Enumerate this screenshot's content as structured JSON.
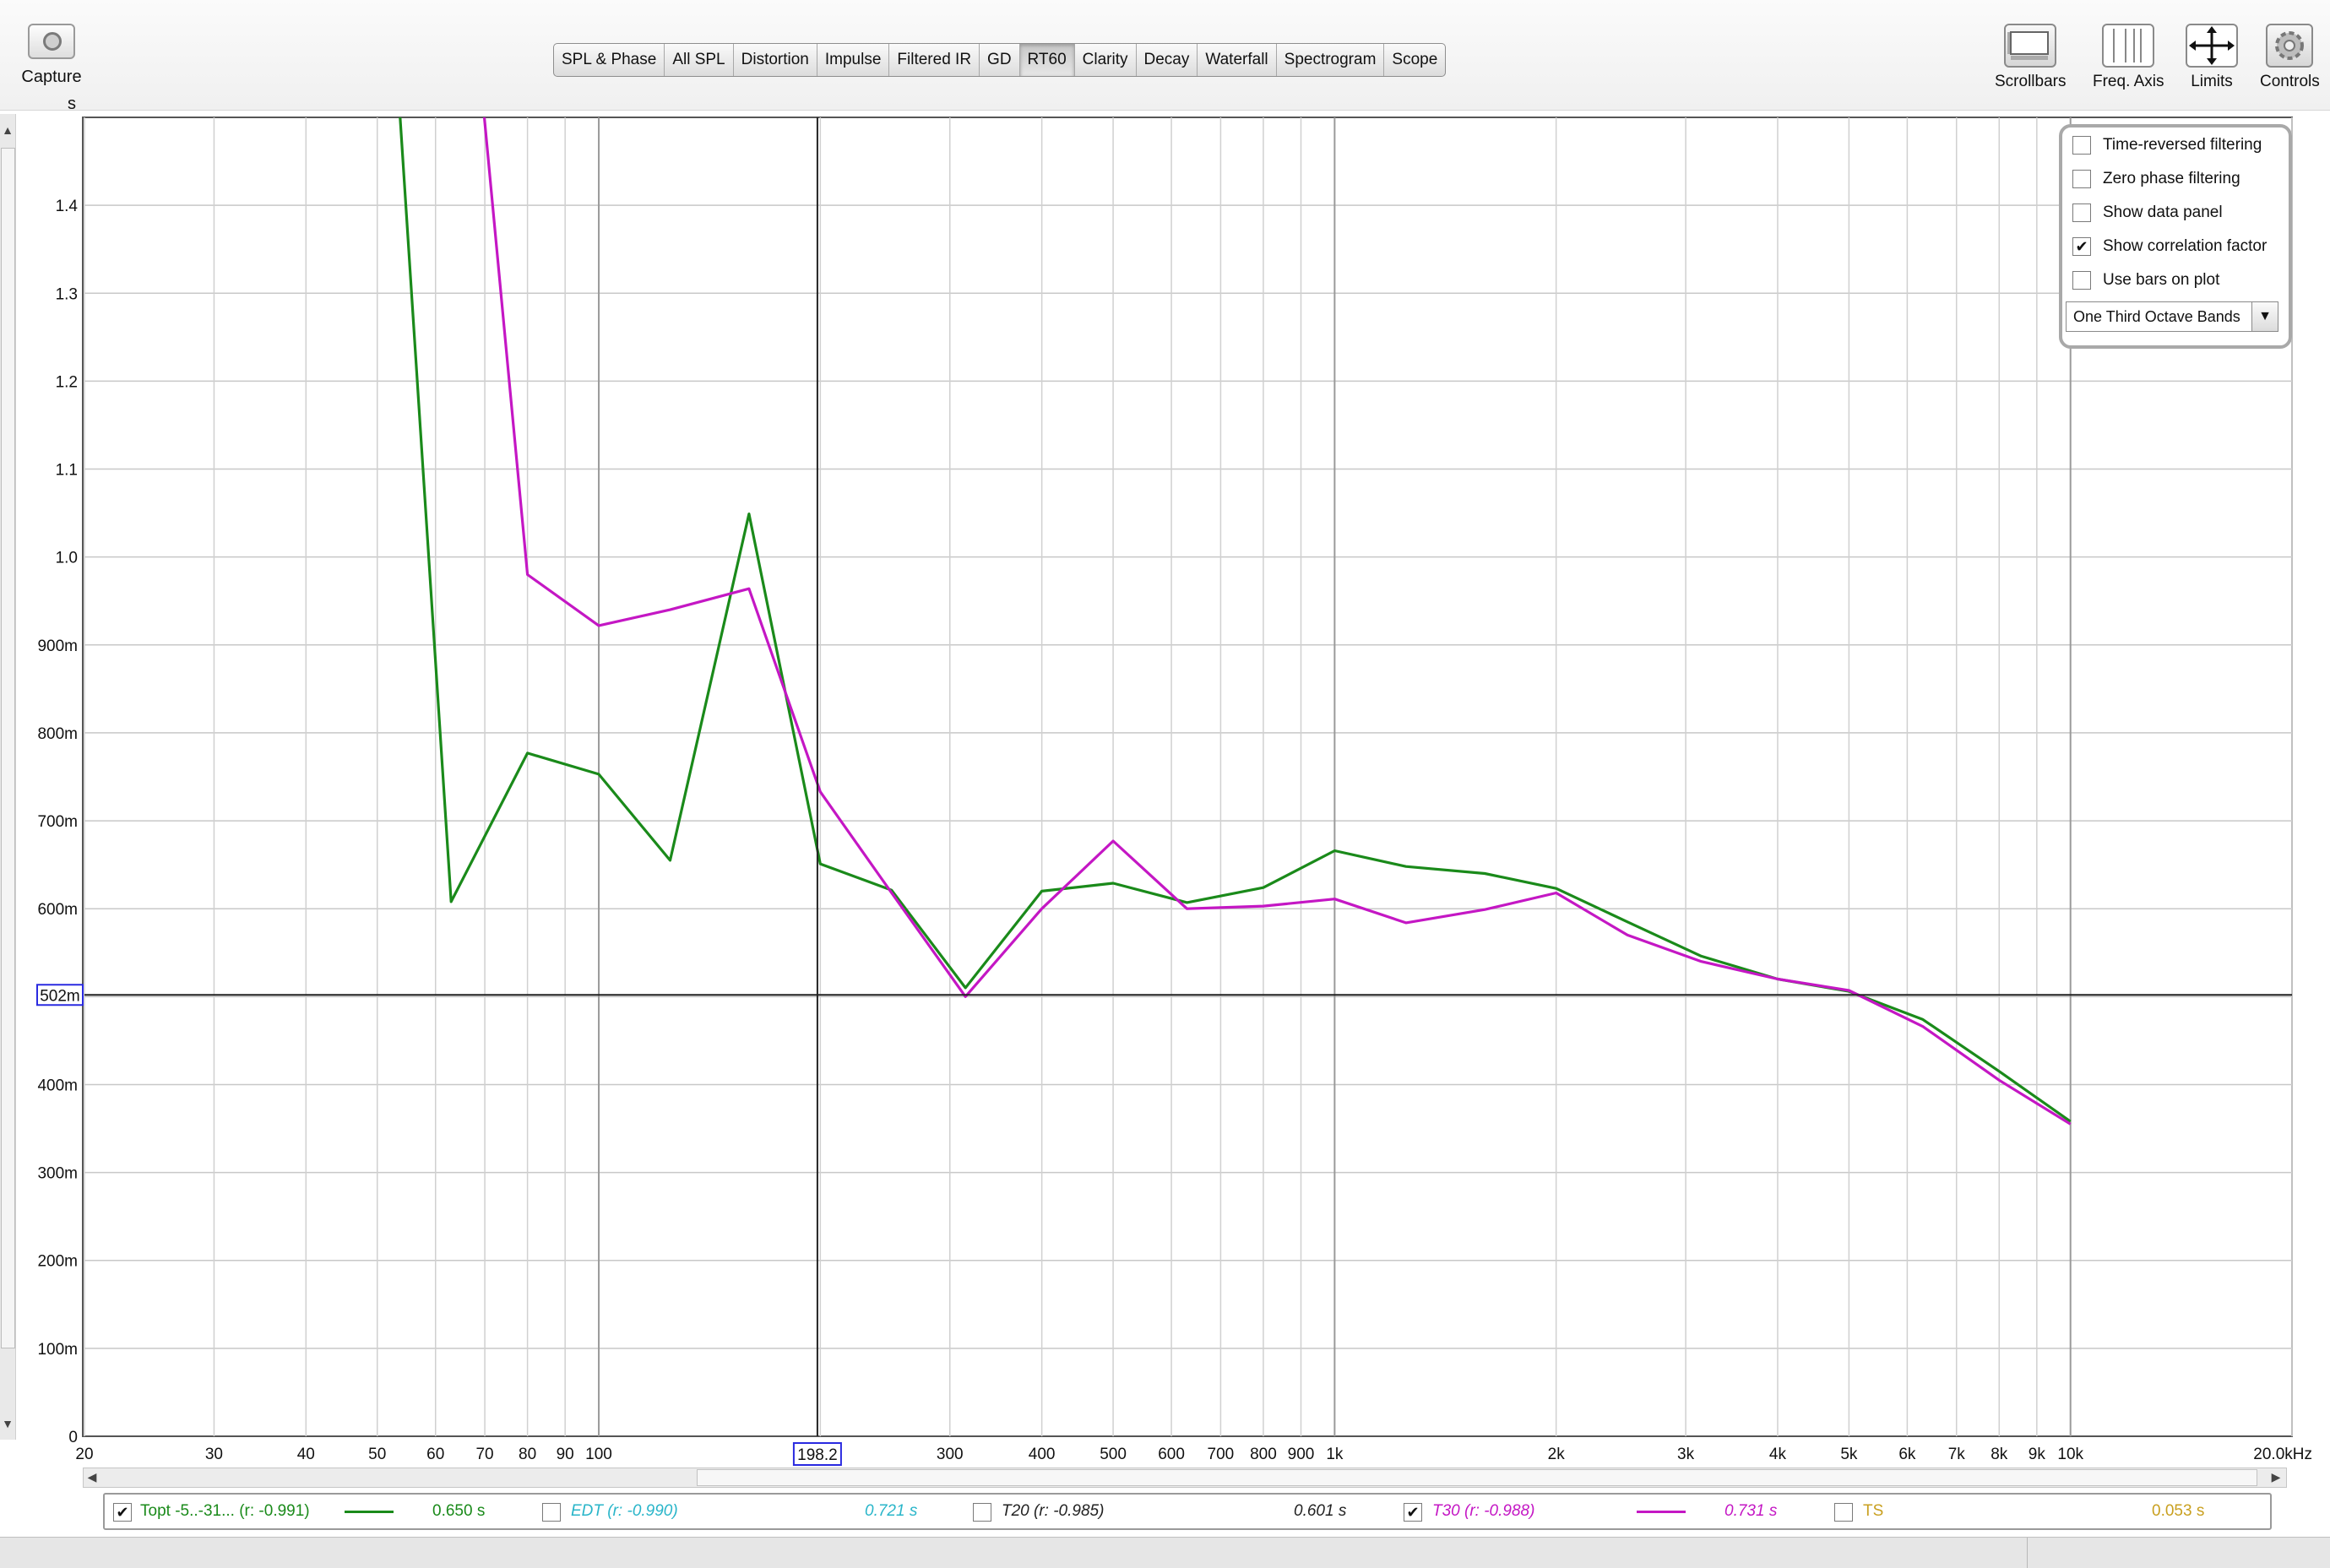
{
  "toolbar": {
    "capture_label": "Capture",
    "unit_label": "s",
    "tabs": [
      {
        "label": "SPL & Phase",
        "active": false
      },
      {
        "label": "All SPL",
        "active": false
      },
      {
        "label": "Distortion",
        "active": false
      },
      {
        "label": "Impulse",
        "active": false
      },
      {
        "label": "Filtered IR",
        "active": false
      },
      {
        "label": "GD",
        "active": false
      },
      {
        "label": "RT60",
        "active": true
      },
      {
        "label": "Clarity",
        "active": false
      },
      {
        "label": "Decay",
        "active": false
      },
      {
        "label": "Waterfall",
        "active": false
      },
      {
        "label": "Spectrogram",
        "active": false
      },
      {
        "label": "Scope",
        "active": false
      }
    ],
    "tools": [
      {
        "label": "Scrollbars",
        "icon": "scrollbars-icon"
      },
      {
        "label": "Freq. Axis",
        "icon": "freq-axis-icon"
      },
      {
        "label": "Limits",
        "icon": "limits-icon"
      },
      {
        "label": "Controls",
        "icon": "gear-icon"
      }
    ]
  },
  "controls": {
    "time_reversed": {
      "label": "Time-reversed filtering",
      "checked": false
    },
    "zero_phase": {
      "label": "Zero phase filtering",
      "checked": false
    },
    "data_panel": {
      "label": "Show data panel",
      "checked": false
    },
    "correlation": {
      "label": "Show correlation factor",
      "checked": true
    },
    "bars": {
      "label": "Use bars on plot",
      "checked": false
    },
    "bands_value": "One Third Octave Bands"
  },
  "cursor": {
    "x_readout": "198.2",
    "y_readout": "502m"
  },
  "chart_data": {
    "type": "line",
    "x_scale": "log",
    "x_unit": "Hz",
    "y_unit": "s",
    "xlim": [
      20,
      20000
    ],
    "ylim": [
      0,
      1.5
    ],
    "y_ticks": [
      {
        "value": 0,
        "label": "0"
      },
      {
        "value": 0.1,
        "label": "100m"
      },
      {
        "value": 0.2,
        "label": "200m"
      },
      {
        "value": 0.3,
        "label": "300m"
      },
      {
        "value": 0.4,
        "label": "400m"
      },
      {
        "value": 0.6,
        "label": "600m"
      },
      {
        "value": 0.7,
        "label": "700m"
      },
      {
        "value": 0.8,
        "label": "800m"
      },
      {
        "value": 0.9,
        "label": "900m"
      },
      {
        "value": 1.0,
        "label": "1.0"
      },
      {
        "value": 1.1,
        "label": "1.1"
      },
      {
        "value": 1.2,
        "label": "1.2"
      },
      {
        "value": 1.3,
        "label": "1.3"
      },
      {
        "value": 1.4,
        "label": "1.4"
      }
    ],
    "x_ticks": [
      {
        "value": 20,
        "label": "20"
      },
      {
        "value": 30,
        "label": "30"
      },
      {
        "value": 40,
        "label": "40"
      },
      {
        "value": 50,
        "label": "50"
      },
      {
        "value": 60,
        "label": "60"
      },
      {
        "value": 70,
        "label": "70"
      },
      {
        "value": 80,
        "label": "80"
      },
      {
        "value": 90,
        "label": "90"
      },
      {
        "value": 100,
        "label": "100"
      },
      {
        "value": 300,
        "label": "300"
      },
      {
        "value": 400,
        "label": "400"
      },
      {
        "value": 500,
        "label": "500"
      },
      {
        "value": 600,
        "label": "600"
      },
      {
        "value": 700,
        "label": "700"
      },
      {
        "value": 800,
        "label": "800"
      },
      {
        "value": 900,
        "label": "900"
      },
      {
        "value": 1000,
        "label": "1k"
      },
      {
        "value": 2000,
        "label": "2k"
      },
      {
        "value": 3000,
        "label": "3k"
      },
      {
        "value": 4000,
        "label": "4k"
      },
      {
        "value": 5000,
        "label": "5k"
      },
      {
        "value": 6000,
        "label": "6k"
      },
      {
        "value": 7000,
        "label": "7k"
      },
      {
        "value": 8000,
        "label": "8k"
      },
      {
        "value": 9000,
        "label": "9k"
      },
      {
        "value": 10000,
        "label": "10k"
      },
      {
        "value": 20000,
        "label": "20.0kHz"
      }
    ],
    "grid": true,
    "cursor": {
      "x": 198.2,
      "y": 0.502
    },
    "series": [
      {
        "name": "Topt -5..-31... (r: -0.991)",
        "color": "#1a8a1a",
        "x": [
          50,
          63,
          80,
          100,
          125,
          160,
          200,
          250,
          315,
          400,
          500,
          630,
          800,
          1000,
          1250,
          1600,
          2000,
          2500,
          3150,
          4000,
          5000,
          6300,
          8000,
          10000
        ],
        "y": [
          1.9,
          0.608,
          0.777,
          0.753,
          0.655,
          1.049,
          0.651,
          0.621,
          0.51,
          0.62,
          0.629,
          0.607,
          0.624,
          0.666,
          0.648,
          0.64,
          0.623,
          0.585,
          0.546,
          0.52,
          0.506,
          0.474,
          0.415,
          0.358
        ]
      },
      {
        "name": "T30 (r: -0.988)",
        "color": "#c417c4",
        "x": [
          63,
          80,
          100,
          125,
          160,
          200,
          250,
          315,
          400,
          500,
          630,
          800,
          1000,
          1250,
          1600,
          2000,
          2500,
          3150,
          4000,
          5000,
          6300,
          8000,
          10000
        ],
        "y": [
          1.9,
          0.98,
          0.922,
          0.94,
          0.964,
          0.733,
          0.618,
          0.5,
          0.6,
          0.677,
          0.6,
          0.603,
          0.611,
          0.584,
          0.599,
          0.618,
          0.57,
          0.54,
          0.52,
          0.507,
          0.466,
          0.405,
          0.355
        ]
      }
    ]
  },
  "legend": {
    "items": [
      {
        "label": "Topt -5..-31... (r: -0.991)",
        "value": "0.650 s",
        "checked": true,
        "color": "#1a8a1a",
        "italic": false
      },
      {
        "label": "EDT (r: -0.990)",
        "value": "0.721 s",
        "checked": false,
        "color": "#29b5c9",
        "italic": true
      },
      {
        "label": "T20 (r: -0.985)",
        "value": "0.601 s",
        "checked": false,
        "color": "#222222",
        "italic": true
      },
      {
        "label": "T30 (r: -0.988)",
        "value": "0.731 s",
        "checked": true,
        "color": "#c417c4",
        "italic": true
      },
      {
        "label": "TS",
        "value": "0.053 s",
        "checked": false,
        "color": "#c9a020",
        "italic": false
      }
    ]
  }
}
